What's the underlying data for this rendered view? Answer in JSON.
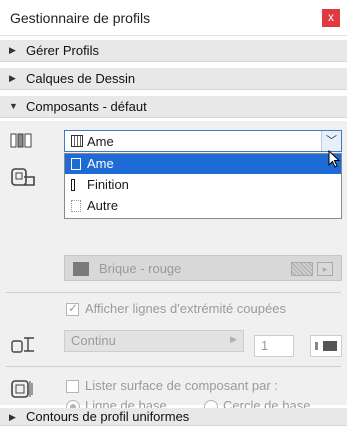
{
  "window": {
    "title": "Gestionnaire de profils",
    "close_glyph": "x"
  },
  "sections": {
    "manage": "Gérer Profils",
    "layers": "Calques de Dessin",
    "components": "Composants - défaut",
    "contours": "Contours de profil uniformes"
  },
  "component_select": {
    "value": "Ame",
    "options": [
      "Ame",
      "Finition",
      "Autre"
    ],
    "selected_index": 0
  },
  "fill": {
    "label": "Brique - rouge"
  },
  "end_lines": {
    "checkbox_label": "Afficher lignes d'extrémité coupées",
    "checked": true,
    "line_type": "Continu",
    "pen_number": "1"
  },
  "surface": {
    "checkbox_label": "Lister surface de composant par :",
    "checked": false,
    "radio_baseline": "Ligne de base",
    "radio_circle": "Cercle de base",
    "selected": "baseline"
  },
  "colors": {
    "accent": "#1e6bd6",
    "close": "#e0393e"
  }
}
